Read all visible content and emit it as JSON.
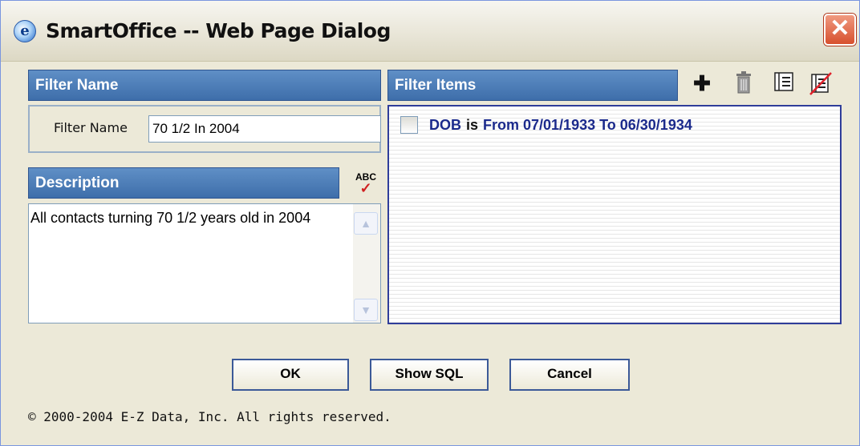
{
  "window": {
    "title": "SmartOffice -- Web Page Dialog",
    "app_icon": "ie-icon",
    "close_symbol": "✕"
  },
  "filter_name_section": {
    "header": "Filter Name",
    "label": "Filter Name",
    "value": "70 1/2 In 2004"
  },
  "description_section": {
    "header": "Description",
    "spell_check_icon": "spell-check-icon",
    "spell_abc": "ABC",
    "spell_check_mark": "✓",
    "value": "All contacts turning 70 1/2 years old in 2004"
  },
  "filter_items_section": {
    "header": "Filter Items",
    "toolbar": [
      {
        "name": "add-item",
        "icon": "plus-icon",
        "symbol": "✚"
      },
      {
        "name": "delete-item",
        "icon": "trash-icon",
        "symbol": "🗑"
      },
      {
        "name": "edit-item",
        "icon": "list-icon",
        "symbol": "☰"
      },
      {
        "name": "clear-items",
        "icon": "clear-list-icon",
        "symbol": "⊘"
      }
    ],
    "items": [
      {
        "field": "DOB",
        "operator": "is",
        "value": "From 07/01/1933 To 06/30/1934",
        "checked": false
      }
    ]
  },
  "buttons": {
    "ok": "OK",
    "show_sql": "Show SQL",
    "cancel": "Cancel"
  },
  "footer": {
    "copyright": "© 2000-2004 E-Z Data, Inc. All rights reserved."
  },
  "colors": {
    "header_bg": "#4a7bb8",
    "item_text": "#1b2a8c",
    "close_red": "#d7502e"
  }
}
